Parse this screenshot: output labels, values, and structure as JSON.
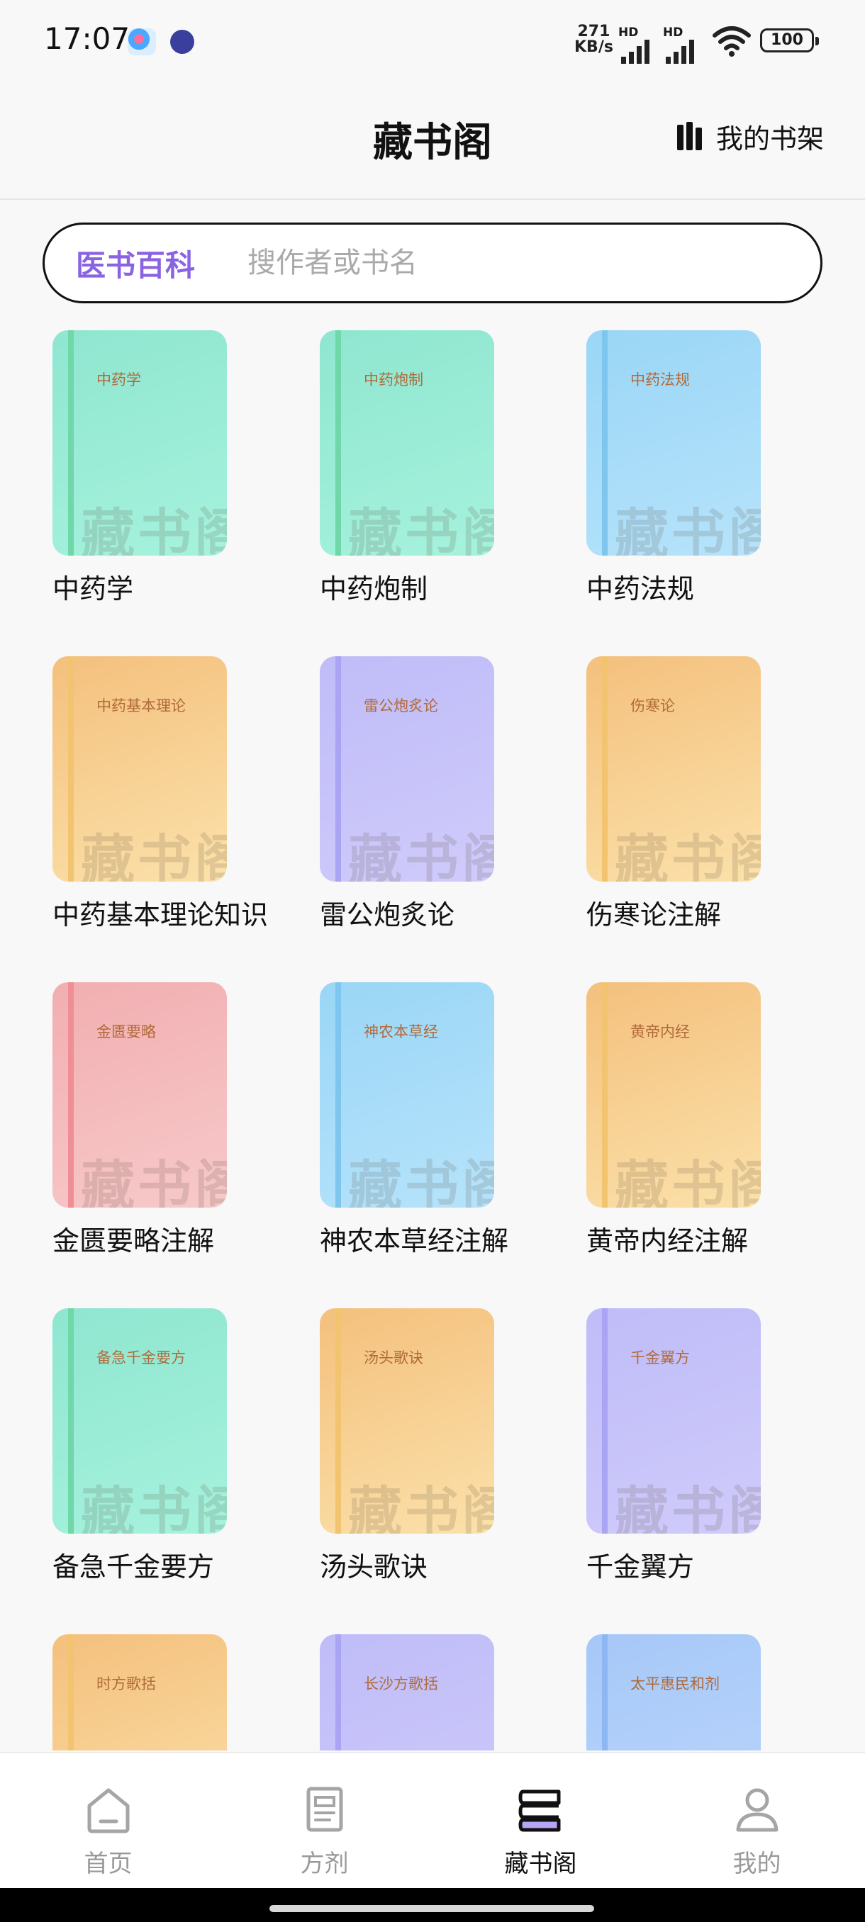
{
  "status_bar": {
    "time": "17:07",
    "net_speed_value": "271",
    "net_speed_unit": "KB/s",
    "sim1_label": "HD",
    "sim2_label": "HD",
    "battery": "100"
  },
  "header": {
    "title": "藏书阁",
    "shelf_label": "我的书架"
  },
  "search": {
    "tab_label": "医书百科",
    "placeholder": "搜作者或书名"
  },
  "watermark": "藏书阁",
  "books": [
    {
      "cover_title": "中药学",
      "name": "中药学",
      "color": "green"
    },
    {
      "cover_title": "中药炮制",
      "name": "中药炮制",
      "color": "green"
    },
    {
      "cover_title": "中药法规",
      "name": "中药法规",
      "color": "blue"
    },
    {
      "cover_title": "中药基本理论",
      "name": "中药基本理论知识",
      "color": "orange"
    },
    {
      "cover_title": "雷公炮炙论",
      "name": "雷公炮炙论",
      "color": "purple"
    },
    {
      "cover_title": "伤寒论",
      "name": "伤寒论注解",
      "color": "orange"
    },
    {
      "cover_title": "金匮要略",
      "name": "金匮要略注解",
      "color": "pink"
    },
    {
      "cover_title": "神农本草经",
      "name": "神农本草经注解",
      "color": "blue"
    },
    {
      "cover_title": "黄帝内经",
      "name": "黄帝内经注解",
      "color": "orange"
    },
    {
      "cover_title": "备急千金要方",
      "name": "备急千金要方",
      "color": "green"
    },
    {
      "cover_title": "汤头歌诀",
      "name": "汤头歌诀",
      "color": "orange"
    },
    {
      "cover_title": "千金翼方",
      "name": "千金翼方",
      "color": "purple"
    },
    {
      "cover_title": "时方歌括",
      "name": "",
      "color": "orange"
    },
    {
      "cover_title": "长沙方歌括",
      "name": "",
      "color": "purple"
    },
    {
      "cover_title": "太平惠民和剂",
      "name": "",
      "color": "lightblue"
    }
  ],
  "colors": {
    "accent": "#8a63e3",
    "nav_active": "#111111",
    "nav_inactive": "#999999"
  },
  "nav": {
    "items": [
      {
        "label": "首页",
        "icon": "home-icon"
      },
      {
        "label": "方剂",
        "icon": "prescription-icon"
      },
      {
        "label": "藏书阁",
        "icon": "library-icon"
      },
      {
        "label": "我的",
        "icon": "profile-icon"
      }
    ]
  }
}
